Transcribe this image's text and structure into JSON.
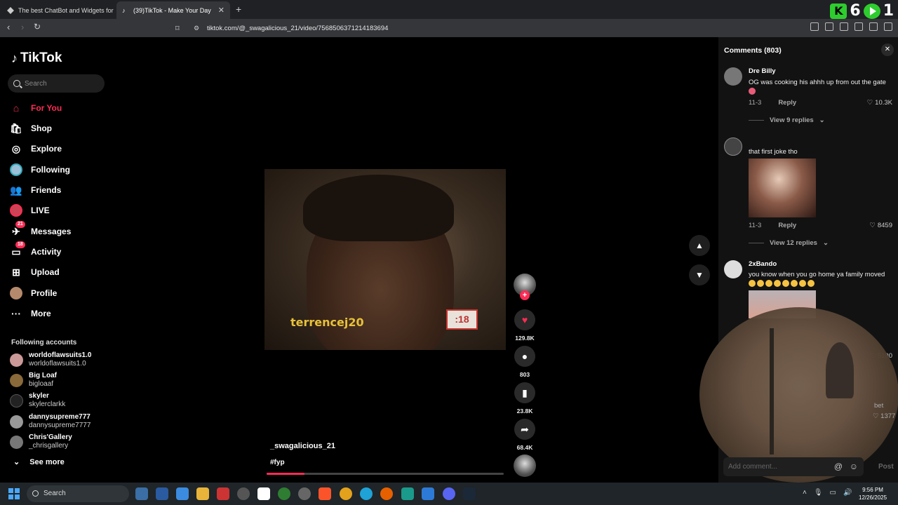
{
  "browser": {
    "tabs": [
      {
        "title": "The best ChatBot and Widgets for Ki"
      },
      {
        "title": "(39)TikTok - Make Your Day"
      }
    ],
    "new_tab_symbol": "+",
    "url": "tiktok.com/@_swagalicious_21/video/7568506371214183694",
    "extension_counts": {
      "k": "6",
      "play": "1"
    }
  },
  "sidebar": {
    "logo": "TikTok",
    "search_placeholder": "Search",
    "nav": [
      {
        "label": "For You",
        "icon": "home-icon"
      },
      {
        "label": "Shop",
        "icon": "shop-icon"
      },
      {
        "label": "Explore",
        "icon": "compass-icon"
      },
      {
        "label": "Following",
        "icon": "following-icon"
      },
      {
        "label": "Friends",
        "icon": "friends-icon"
      },
      {
        "label": "LIVE",
        "icon": "live-icon"
      },
      {
        "label": "Messages",
        "icon": "messages-icon",
        "badge": "21"
      },
      {
        "label": "Activity",
        "icon": "activity-icon",
        "badge": "18"
      },
      {
        "label": "Upload",
        "icon": "upload-icon"
      },
      {
        "label": "Profile",
        "icon": "profile-icon"
      },
      {
        "label": "More",
        "icon": "more-icon"
      }
    ],
    "following_heading": "Following accounts",
    "following": [
      {
        "name": "worldoflawsuits1.0",
        "handle": "worldoflawsuits1.0"
      },
      {
        "name": "Big Loaf",
        "handle": "bigloaaf"
      },
      {
        "name": "skyler",
        "handle": "skylerclarkk"
      },
      {
        "name": "dannysupreme777",
        "handle": "dannysupreme7777"
      },
      {
        "name": "Chris'Gallery",
        "handle": "_chrisgallery"
      }
    ],
    "see_more": "See more"
  },
  "video": {
    "watermark": "terrencej20",
    "counter": ":18",
    "author": "_swagalicious_21",
    "hashtag": "#fyp",
    "progress": 0.16,
    "likes": "129.8K",
    "comments": "803",
    "saves": "23.8K",
    "shares": "68.4K"
  },
  "comments_panel": {
    "title": "Comments (803)",
    "comments": [
      {
        "user": "Dre Billy",
        "text": "OG was cooking his ahhh up from out the gate",
        "date": "11-3",
        "reply": "Reply",
        "likes": "10.3K",
        "view_replies": "View 9 replies"
      },
      {
        "user": "",
        "text": "that first joke tho",
        "date": "11-3",
        "reply": "Reply",
        "likes": "8459",
        "view_replies": "View 12 replies"
      },
      {
        "user": "2xBando",
        "text": "you know when you go home ya family moved",
        "likes": "5190"
      }
    ],
    "partial_text": "bet",
    "partial_likes": "1377",
    "input_placeholder": "Add comment...",
    "post_label": "Post"
  },
  "taskbar": {
    "search_label": "Search",
    "time": "9:56 PM",
    "date": "12/26/2025"
  }
}
